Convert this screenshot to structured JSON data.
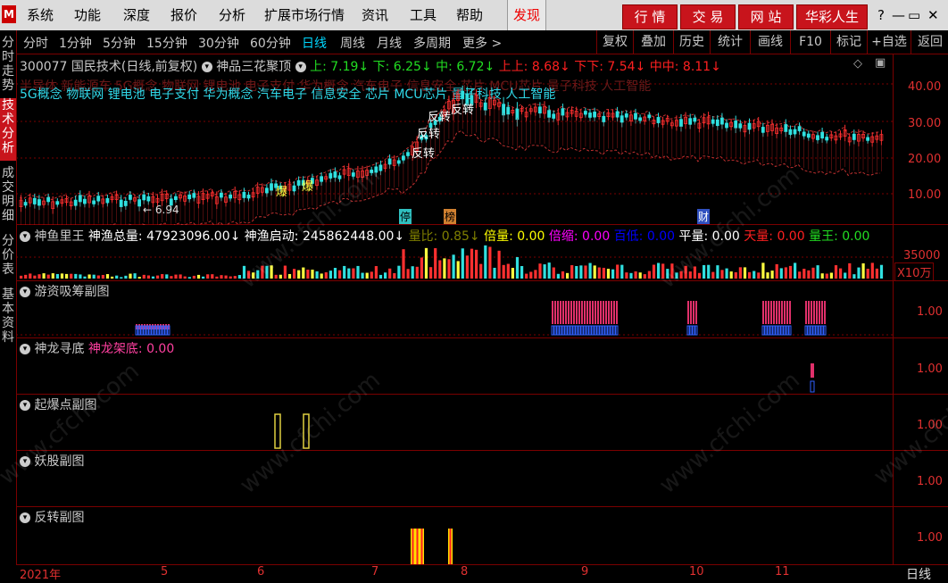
{
  "menubar": {
    "logo": "M",
    "items": [
      "系统",
      "功能",
      "深度",
      "报价",
      "分析",
      "扩展市场行情",
      "资讯",
      "工具",
      "帮助"
    ],
    "discover": "发现",
    "buttons": [
      "行 情",
      "交 易",
      "网 站",
      "华彩人生"
    ],
    "window_controls": [
      "?",
      "—",
      "▭",
      "✕"
    ]
  },
  "toolbar": {
    "periods": [
      "分时",
      "1分钟",
      "5分钟",
      "15分钟",
      "30分钟",
      "60分钟",
      "日线",
      "周线",
      "月线",
      "多周期",
      "更多 >"
    ],
    "active_period": "日线",
    "right": [
      "复权",
      "叠加",
      "历史",
      "统计",
      "画线",
      "F10",
      "标记",
      "+自选",
      "返回"
    ]
  },
  "left_tabs": [
    "分时走势",
    "技术分析",
    "成交明细",
    "分价表",
    "基本资料"
  ],
  "main_chart": {
    "stock": "300077 国民技术(日线,前复权)",
    "indicator": "神品三花聚顶",
    "params": [
      {
        "label": "上: 7.19↓",
        "color": "#22dd22"
      },
      {
        "label": "下: 6.25↓",
        "color": "#22dd22"
      },
      {
        "label": "中: 6.72↓",
        "color": "#22dd22"
      },
      {
        "label": "上上: 8.68↓",
        "color": "#ff2020"
      },
      {
        "label": "下下: 7.54↓",
        "color": "#ff2020"
      },
      {
        "label": "中中: 8.11↓",
        "color": "#ff2020"
      }
    ],
    "concepts": "5G概念 物联网 锂电池 电子支付 华为概念 汽车电子 信息安全 芯片 MCU芯片 量子科技 人工智能",
    "concepts_faded": "半导体 新能源车 5G概念 物联网 锂电池 电子支付 华为概念 汽车电子 信息安全 芯片 MCU芯片 量子科技 人工智能",
    "y_ticks": [
      "40.00",
      "30.00",
      "20.00",
      "10.00"
    ],
    "low_marker": "← 6.94",
    "markers": {
      "bao1": "爆",
      "bao2": "爆",
      "fanzhuan1": "反转",
      "fanzhuan2": "反转",
      "fanzhuan3": "反转",
      "fanzhuan4": "反转"
    },
    "events": {
      "ting": "停",
      "bang": "榜",
      "cai": "财"
    }
  },
  "volume_panel": {
    "name": "神鱼里王",
    "fields": [
      {
        "label": "神渔总量: 47923096.00↓",
        "color": "#ffffff"
      },
      {
        "label": "神渔启动: 245862448.00↓",
        "color": "#ffffff"
      },
      {
        "label": "量比: 0.85↓",
        "color": "#808000"
      },
      {
        "label": "倍量: 0.00",
        "color": "#ffff00"
      },
      {
        "label": "倍缩: 0.00",
        "color": "#ff00ff"
      },
      {
        "label": "百低: 0.00",
        "color": "#0000ff"
      },
      {
        "label": "平量: 0.00",
        "color": "#ffffff"
      },
      {
        "label": "天量: 0.00",
        "color": "#ff2020"
      },
      {
        "label": "量王: 0.00",
        "color": "#22dd22"
      }
    ],
    "y_tick": "35000",
    "unit": "X10万"
  },
  "sub_panels": [
    {
      "name": "游资吸筹副图",
      "extra": "",
      "tick": "1.00"
    },
    {
      "name": "神龙寻底",
      "extra": "神龙架底: 0.00",
      "tick": "1.00"
    },
    {
      "name": "起爆点副图",
      "extra": "",
      "tick": "1.00"
    },
    {
      "name": "妖股副图",
      "extra": "",
      "tick": "1.00"
    },
    {
      "name": "反转副图",
      "extra": "",
      "tick": "1.00"
    }
  ],
  "x_axis": {
    "labels": [
      "2021年",
      "5",
      "6",
      "7",
      "8",
      "9",
      "10",
      "11"
    ],
    "period_label": "日线"
  },
  "watermark": "www.cfchi.com"
}
